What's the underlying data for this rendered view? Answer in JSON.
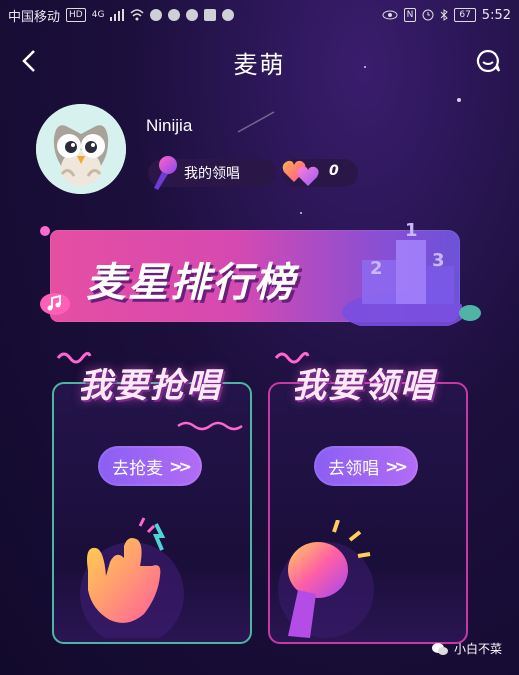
{
  "status_bar": {
    "carrier": "中国移动",
    "hd_tag": "HD",
    "signal_tag": "4G",
    "battery": "67",
    "time": "5:52"
  },
  "header": {
    "title": "麦萌"
  },
  "profile": {
    "username": "Ninijia",
    "lead_singing_label": "我的领唱",
    "hearts_count": "0"
  },
  "ranking_banner": {
    "title": "麦星排行榜"
  },
  "cards": {
    "grab": {
      "title": "我要抢唱",
      "button": "去抢麦"
    },
    "lead": {
      "title": "我要领唱",
      "button": "去领唱"
    }
  },
  "watermark": {
    "text": "小白不菜"
  },
  "colors": {
    "background": "#1c0f3d",
    "accent_purple": "#8a5ff3",
    "accent_pink": "#e54fa2",
    "card_left_border": "#4fb4a3",
    "card_right_border": "#c43aa3"
  }
}
